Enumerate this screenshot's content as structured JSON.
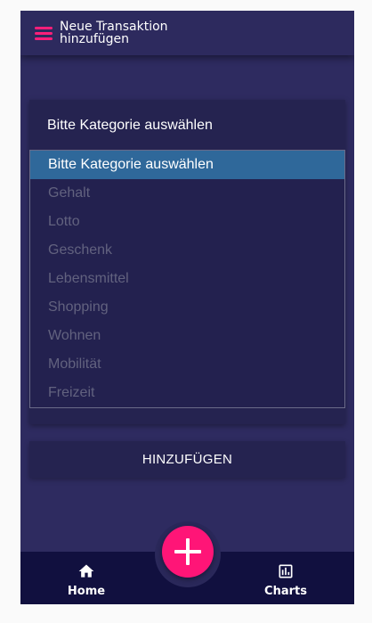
{
  "header": {
    "title": "Neue Transaktion hinzufügen",
    "menu_icon": "hamburger-menu-icon"
  },
  "form": {
    "category_select": {
      "selected": "Bitte Kategorie auswählen",
      "options": [
        "Bitte Kategorie auswählen",
        "Gehalt",
        "Lotto",
        "Geschenk",
        "Lebensmittel",
        "Shopping",
        "Wohnen",
        "Mobilität",
        "Freizeit"
      ]
    },
    "submit_label": "HINZUFÜGEN"
  },
  "bottom_nav": {
    "items": [
      {
        "label": "Home",
        "icon": "home-icon"
      },
      {
        "label": "Charts",
        "icon": "bar-chart-icon"
      }
    ],
    "fab_icon": "plus-icon"
  },
  "colors": {
    "background": "#2e2b60",
    "app_bar": "#2d2a5e",
    "card": "#252350",
    "accent": "#ff1577",
    "selected_option": "#2f689a",
    "bottom_nav": "#11103f",
    "disabled_option_text": "#62627f"
  }
}
